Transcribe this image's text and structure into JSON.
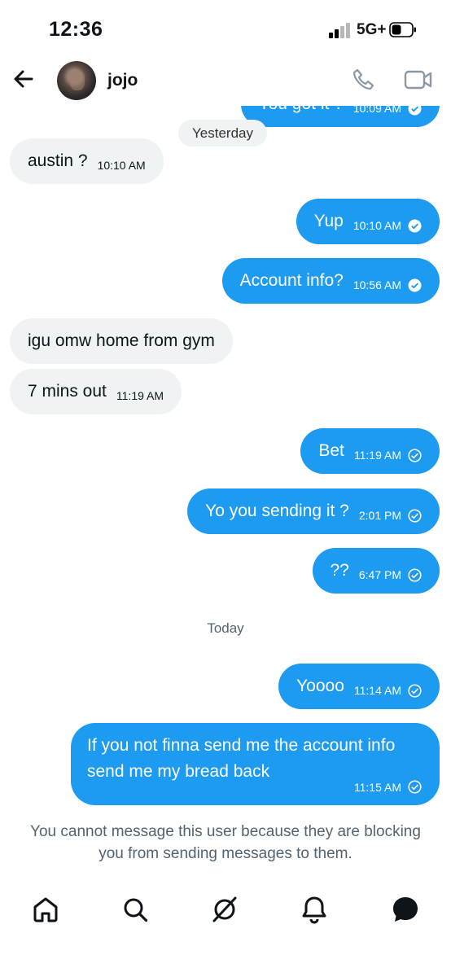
{
  "status_bar": {
    "time": "12:36",
    "network": "5G+"
  },
  "header": {
    "contact_name": "jojo"
  },
  "messages": [
    {
      "side": "out",
      "text": "You got it ?",
      "time": "10:09 AM",
      "status": "read"
    },
    {
      "side": "in",
      "text": "austin ?",
      "time": "10:10 AM"
    },
    {
      "side": "out",
      "text": "Yup",
      "time": "10:10 AM",
      "status": "read"
    },
    {
      "side": "out",
      "text": "Account info?",
      "time": "10:56 AM",
      "status": "read"
    },
    {
      "side": "in",
      "text": "igu omw home from gym",
      "time": ""
    },
    {
      "side": "in",
      "text": "7 mins out",
      "time": "11:19 AM"
    },
    {
      "side": "out",
      "text": "Bet",
      "time": "11:19 AM",
      "status": "sent"
    },
    {
      "side": "out",
      "text": "Yo you sending it ?",
      "time": "2:01 PM",
      "status": "sent"
    },
    {
      "side": "out",
      "text": "??",
      "time": "6:47 PM",
      "status": "sent"
    },
    {
      "side": "out",
      "text": "Yoooo",
      "time": "11:14 AM",
      "status": "sent"
    },
    {
      "side": "out",
      "text": "If you not finna send me the account info send me my bread back",
      "time": "11:15 AM",
      "status": "sent"
    }
  ],
  "date_separators": {
    "yesterday": "Yesterday",
    "today": "Today"
  },
  "blocked_notice": "You cannot message this user because they are blocking you from sending messages to them.",
  "bottom_nav": [
    "home-icon",
    "search-icon",
    "grok-icon",
    "notifications-icon",
    "messages-icon"
  ],
  "colors": {
    "accent": "#1d9bf0",
    "incoming_bubble": "#eff3f4",
    "muted_text": "#536471"
  }
}
